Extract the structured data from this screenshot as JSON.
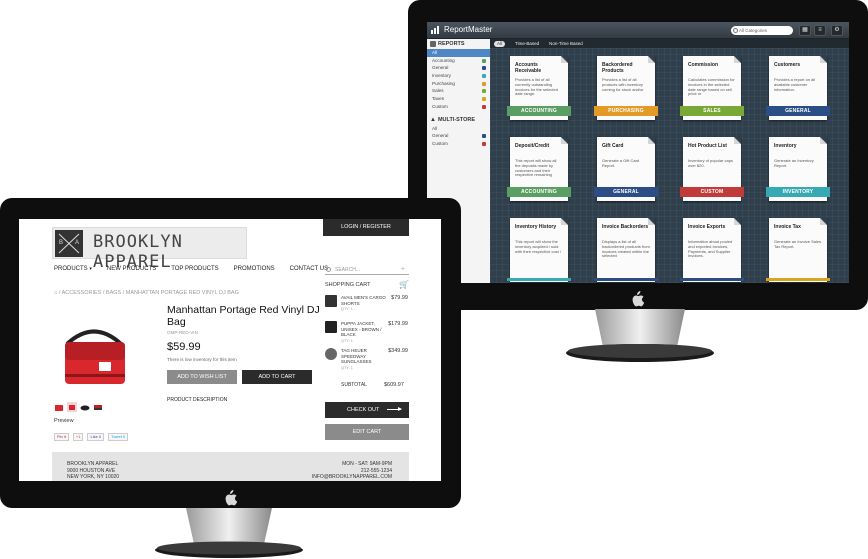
{
  "report_master": {
    "brand": "ReportMaster",
    "search_placeholder": "All Categories",
    "sidebar": {
      "reports_heading": "REPORTS",
      "reports_items": [
        {
          "label": "All",
          "active": true,
          "color": ""
        },
        {
          "label": "Accounting",
          "color": "#5a9e63"
        },
        {
          "label": "General",
          "color": "#2c4e86"
        },
        {
          "label": "Inventory",
          "color": "#37a9b5"
        },
        {
          "label": "Purchasing",
          "color": "#e39a27"
        },
        {
          "label": "Sales",
          "color": "#7aa837"
        },
        {
          "label": "Taxes",
          "color": "#d8a520"
        },
        {
          "label": "Custom",
          "color": "#c23b3b"
        }
      ],
      "multistore_heading": "MULTI-STORE",
      "multistore_items": [
        {
          "label": "All",
          "color": ""
        },
        {
          "label": "General",
          "color": "#2c4e86"
        },
        {
          "label": "Custom",
          "color": "#c23b3b"
        }
      ]
    },
    "tabs": {
      "all": "All",
      "time_based": "Time-Based",
      "non_time_based": "Non-Time Based"
    },
    "cards": [
      {
        "title": "Accounts Receivable",
        "desc": "Provides a list of all currently outstanding invoices for the selected date range.",
        "ribbon": "ACCOUNTING",
        "color": "#5a9e63"
      },
      {
        "title": "Backordered Products",
        "desc": "Provides a list of all products with inventory coming for stock and/or",
        "ribbon": "PURCHASING",
        "color": "#e39a27"
      },
      {
        "title": "Commission",
        "desc": "Calculates commission for invoices in the selected date range based on sell price or",
        "ribbon": "SALES",
        "color": "#7aa837"
      },
      {
        "title": "Customers",
        "desc": "Provides a report on all available customer information.",
        "ribbon": "GENERAL",
        "color": "#2c4e86"
      },
      {
        "title": "Deposit/Credit",
        "desc": "This report will show all the deposits made by customers and their respective remaining",
        "ribbon": "ACCOUNTING",
        "color": "#5a9e63"
      },
      {
        "title": "Gift Card",
        "desc": "Generate a Gift Card Report.",
        "ribbon": "GENERAL",
        "color": "#2c4e86"
      },
      {
        "title": "Hot Product List",
        "desc": "Inventory of popular caps over $20.",
        "ribbon": "CUSTOM",
        "color": "#c23b3b"
      },
      {
        "title": "Inventory",
        "desc": "Generate an Inventory Report.",
        "ribbon": "INVENTORY",
        "color": "#37a9b5"
      },
      {
        "title": "Inventory History",
        "desc": "This report will show the inventory acquired / sold with their respective cost /",
        "ribbon": "",
        "color": "#37a9b5"
      },
      {
        "title": "Invoice Backorders",
        "desc": "Displays a list of all backordered products from invoices created within the selected",
        "ribbon": "",
        "color": "#2c4e86"
      },
      {
        "title": "Invoice Exports",
        "desc": "Information about pooled and exported Invoices, Payments, and Supplier Invoices.",
        "ribbon": "",
        "color": "#2c4e86"
      },
      {
        "title": "Invoice Tax",
        "desc": "Generate an Invoice Sales Tax Report.",
        "ribbon": "",
        "color": "#d8a520"
      }
    ]
  },
  "store": {
    "brand_name": "BROOKLYN APPAREL",
    "badge_letters": [
      "B",
      "A"
    ],
    "login": "LOGIN / REGISTER",
    "nav": [
      "PRODUCTS",
      "NEW PRODUCTS",
      "TOP PRODUCTS",
      "PROMOTIONS",
      "CONTACT US"
    ],
    "search_placeholder": "SEARCH...",
    "breadcrumb": "/ ACCESSORIES / BAGS / MANHATTAN PORTAGE RED VINYL DJ BAG",
    "product": {
      "title": "Manhattan Portage Red Vinyl DJ Bag",
      "sku": "OMP-RED-VIN",
      "price": "$59.99",
      "stock_note": "There is low inventory for this item",
      "wishlist_label": "ADD TO WISH LIST",
      "add_to_cart_label": "ADD TO CART",
      "description_label": "PRODUCT DESCRIPTION",
      "preview_label": "Preview"
    },
    "social": [
      "Pin it",
      "+1",
      "Like 0",
      "Tweet 0"
    ],
    "cart": {
      "heading": "SHOPPING CART",
      "items": [
        {
          "name": "AVAIL MEN'S CARGO SHORTS",
          "qty": "QTY: 1",
          "price": "$79.99"
        },
        {
          "name": "PUPPA JACKET, UNISEX - BROWN / BLACK",
          "qty": "QTY: 1",
          "price": "$179.99"
        },
        {
          "name": "TAG HEUER SPEEDWAY SUNGLASSES",
          "qty": "QTY: 1",
          "price": "$349.99"
        }
      ],
      "subtotal_label": "SUBTOTAL",
      "subtotal_value": "$609.97",
      "checkout_label": "CHECK OUT",
      "edit_label": "EDIT CART"
    },
    "footer": {
      "name": "BROOKLYN APPAREL",
      "address1": "9000 HOUSTON AVE",
      "address2": "NEW YORK, NY 10020",
      "hours": "MON - SAT: 9AM-9PM",
      "phone": "212-555-1234",
      "email": "INFO@BROOKLYNAPPAREL.COM"
    }
  }
}
